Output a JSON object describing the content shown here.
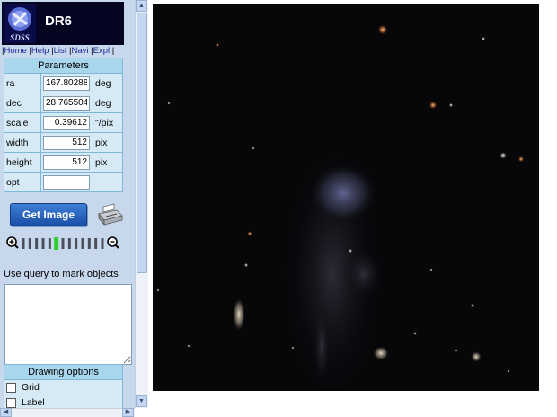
{
  "app": {
    "logo_text": "SDSS",
    "release": "DR6"
  },
  "nav": {
    "links": [
      "Home",
      "Help",
      "List",
      "Navi",
      "Expl"
    ]
  },
  "parameters": {
    "title": "Parameters",
    "rows": [
      {
        "label": "ra",
        "value": "167.80288",
        "unit": "deg"
      },
      {
        "label": "dec",
        "value": "28.765504",
        "unit": "deg"
      },
      {
        "label": "scale",
        "value": "0.39612",
        "unit": "\"/pix"
      },
      {
        "label": "width",
        "value": "512",
        "unit": "pix"
      },
      {
        "label": "height",
        "value": "512",
        "unit": "pix"
      },
      {
        "label": "opt",
        "value": "",
        "unit": ""
      }
    ]
  },
  "actions": {
    "get_image_label": "Get Image",
    "print_icon": "printer-icon"
  },
  "zoom": {
    "level": 5,
    "steps": 13,
    "zoom_in_icon": "zoom-in-icon",
    "zoom_out_icon": "zoom-out-icon"
  },
  "query": {
    "label": "Use query to mark objects",
    "value": ""
  },
  "drawing_options": {
    "title": "Drawing options",
    "items": [
      {
        "label": "Grid",
        "checked": false
      },
      {
        "label": "Label",
        "checked": false
      }
    ]
  },
  "colors": {
    "panel_bg": "#c8d8ec",
    "header_bg": "#a8d6ec",
    "button_blue": "#1a4fa8",
    "sky_bg": "#07070a"
  }
}
